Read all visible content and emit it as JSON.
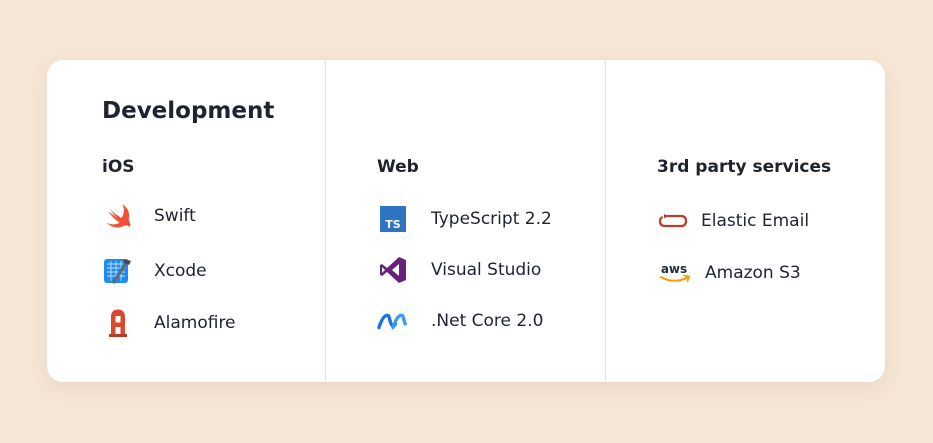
{
  "card": {
    "title": "Development",
    "columns": [
      {
        "heading": "iOS",
        "items": [
          {
            "label": "Swift",
            "icon": "swift-icon"
          },
          {
            "label": "Xcode",
            "icon": "xcode-icon"
          },
          {
            "label": "Alamofire",
            "icon": "alamofire-icon"
          }
        ]
      },
      {
        "heading": "Web",
        "items": [
          {
            "label": "TypeScript 2.2",
            "icon": "typescript-icon",
            "icon_text": "TS"
          },
          {
            "label": "Visual Studio",
            "icon": "visual-studio-icon"
          },
          {
            "label": ".Net Core 2.0",
            "icon": "dotnet-icon"
          }
        ]
      },
      {
        "heading": "3rd party services",
        "items": [
          {
            "label": "Elastic Email",
            "icon": "elastic-email-icon"
          },
          {
            "label": "Amazon S3",
            "icon": "aws-icon",
            "icon_text": "aws"
          }
        ]
      }
    ]
  },
  "colors": {
    "background": "#f6e6d5",
    "card": "#ffffff",
    "text": "#1f2330",
    "divider": "#e3e3e3",
    "swift": "#f05138",
    "xcode": "#1f8ceb",
    "alamofire": "#d8492f",
    "typescript": "#2f74c0",
    "visual_studio": "#68217a",
    "dotnet": "#1e73d8",
    "elastic_email": "#c0392b",
    "aws_orange": "#ff9900"
  }
}
